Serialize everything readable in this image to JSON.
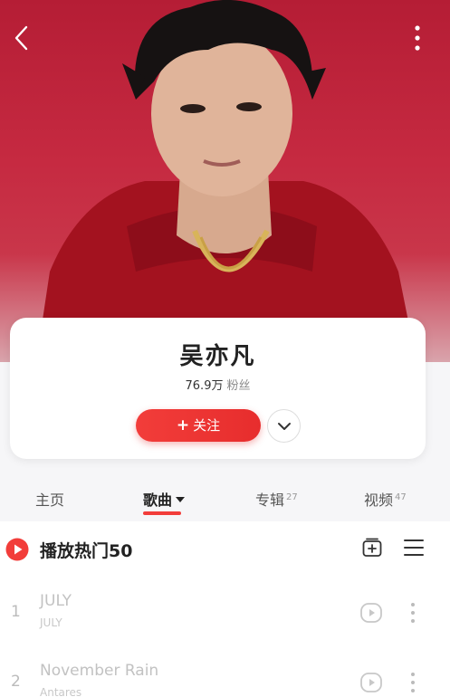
{
  "artist": {
    "name": "吴亦凡",
    "fans_count": "76.9万",
    "fans_label": "粉丝",
    "follow_label": "关注",
    "follow_plus": "+"
  },
  "tabs": [
    {
      "label": "主页",
      "count": ""
    },
    {
      "label": "歌曲",
      "count": ""
    },
    {
      "label": "专辑",
      "count": "27"
    },
    {
      "label": "视频",
      "count": "47"
    }
  ],
  "active_tab": "歌曲",
  "section": {
    "title": "播放热门50"
  },
  "songs": [
    {
      "index": "1",
      "title": "JULY",
      "subtitle": "JULY"
    },
    {
      "index": "2",
      "title": "November Rain",
      "subtitle": "Antares"
    }
  ],
  "colors": {
    "accent": "#f23d3a",
    "hero_background": "#c62a41",
    "page_background": "#f6f6f8"
  },
  "icons": {
    "back": "chevron-left-icon",
    "more": "more-vertical-icon",
    "expand": "chevron-down-icon",
    "play_all": "play-circle-icon",
    "collect": "add-to-collection-icon",
    "list": "list-menu-icon",
    "mv": "video-play-icon",
    "song_more": "more-vertical-icon"
  }
}
